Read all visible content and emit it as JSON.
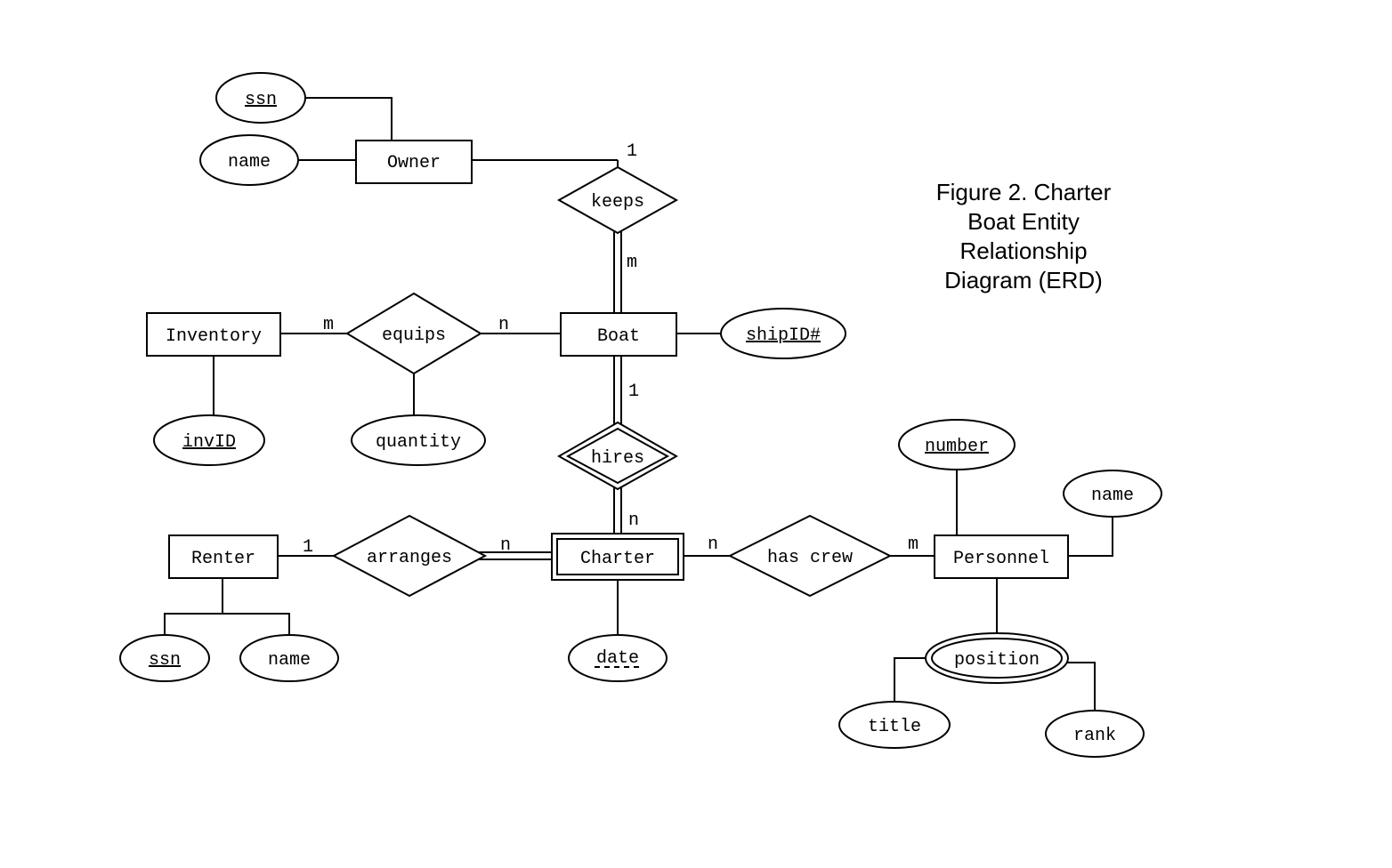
{
  "figure_title": [
    "Figure 2. Charter",
    "Boat Entity",
    "Relationship",
    "Diagram (ERD)"
  ],
  "entities": {
    "owner": "Owner",
    "inventory": "Inventory",
    "boat": "Boat",
    "renter": "Renter",
    "charter": "Charter",
    "personnel": "Personnel"
  },
  "relationships": {
    "keeps": "keeps",
    "equips": "equips",
    "hires": "hires",
    "arranges": "arranges",
    "has_crew": "has crew"
  },
  "attributes": {
    "owner_ssn": "ssn",
    "owner_name": "name",
    "inventory_invid": "invID",
    "equips_quantity": "quantity",
    "boat_shipid": "shipID#",
    "renter_ssn": "ssn",
    "renter_name": "name",
    "charter_date": "date",
    "personnel_number": "number",
    "personnel_name": "name",
    "personnel_position": "position",
    "position_title": "title",
    "position_rank": "rank"
  },
  "cardinalities": {
    "keeps_1": "1",
    "keeps_m": "m",
    "equips_m": "m",
    "equips_n": "n",
    "hires_1": "1",
    "hires_n": "n",
    "arranges_1": "1",
    "arranges_n": "n",
    "hascrew_n": "n",
    "hascrew_m": "m"
  }
}
